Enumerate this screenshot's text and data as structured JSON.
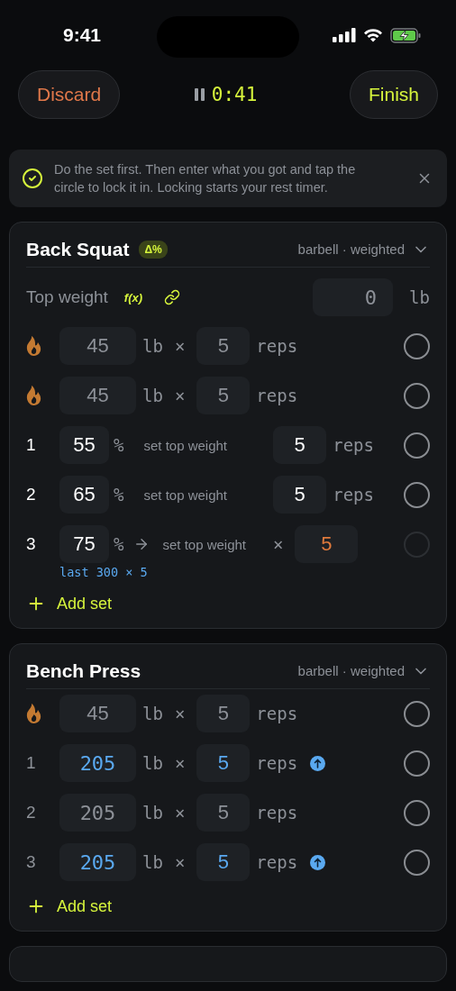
{
  "status_bar": {
    "time": "9:41"
  },
  "header": {
    "discard": "Discard",
    "paused": true,
    "timer": "0:41",
    "finish": "Finish"
  },
  "tip": {
    "text": "Do the set first. Then enter what you got and tap the circle to lock it in. Locking starts your rest timer.",
    "dismissible": true
  },
  "exercises": [
    {
      "name": "Back Squat",
      "badge": "Δ%",
      "meta": "barbell · weighted",
      "expanded": true,
      "top_weight": {
        "label": "Top weight",
        "formula": "f(x)",
        "linked": true,
        "value": "0",
        "unit": "lb"
      },
      "sets": [
        {
          "kind": "warmup",
          "weight": "45",
          "unit": "lb",
          "times": "×",
          "reps": "5",
          "reps_label": "reps",
          "increased": false,
          "done": false,
          "disabled": false
        },
        {
          "kind": "warmup",
          "weight": "45",
          "unit": "lb",
          "times": "×",
          "reps": "5",
          "reps_label": "reps",
          "increased": false,
          "done": false,
          "disabled": false
        },
        {
          "kind": "percent",
          "index": "1",
          "percent": "55",
          "percent_sign": "%",
          "target": "set top weight",
          "reps": "5",
          "reps_label": "reps",
          "arrow": false,
          "pending": false,
          "done": false,
          "disabled": false
        },
        {
          "kind": "percent",
          "index": "2",
          "percent": "65",
          "percent_sign": "%",
          "target": "set top weight",
          "reps": "5",
          "reps_label": "reps",
          "arrow": false,
          "pending": false,
          "done": false,
          "disabled": false
        },
        {
          "kind": "percent",
          "index": "3",
          "percent": "75",
          "percent_sign": "%",
          "target": "set top weight",
          "times": "×",
          "reps": "5",
          "arrow": true,
          "pending": true,
          "note": "last 300 × 5",
          "done": false,
          "disabled": true
        }
      ],
      "add_label": "Add set"
    },
    {
      "name": "Bench Press",
      "meta": "barbell · weighted",
      "expanded": true,
      "sets": [
        {
          "kind": "warmup",
          "weight": "45",
          "unit": "lb",
          "times": "×",
          "reps": "5",
          "reps_label": "reps",
          "increased": false,
          "done": false,
          "disabled": false
        },
        {
          "kind": "weight",
          "index": "1",
          "weight": "205",
          "unit": "lb",
          "times": "×",
          "reps": "5",
          "reps_label": "reps",
          "increased": true,
          "done": false,
          "disabled": false
        },
        {
          "kind": "weight",
          "index": "2",
          "weight": "205",
          "unit": "lb",
          "times": "×",
          "reps": "5",
          "reps_label": "reps",
          "increased": false,
          "done": false,
          "disabled": false
        },
        {
          "kind": "weight",
          "index": "3",
          "weight": "205",
          "unit": "lb",
          "times": "×",
          "reps": "5",
          "reps_label": "reps",
          "increased": true,
          "done": false,
          "disabled": false
        }
      ],
      "add_label": "Add set"
    }
  ],
  "more_below": true
}
